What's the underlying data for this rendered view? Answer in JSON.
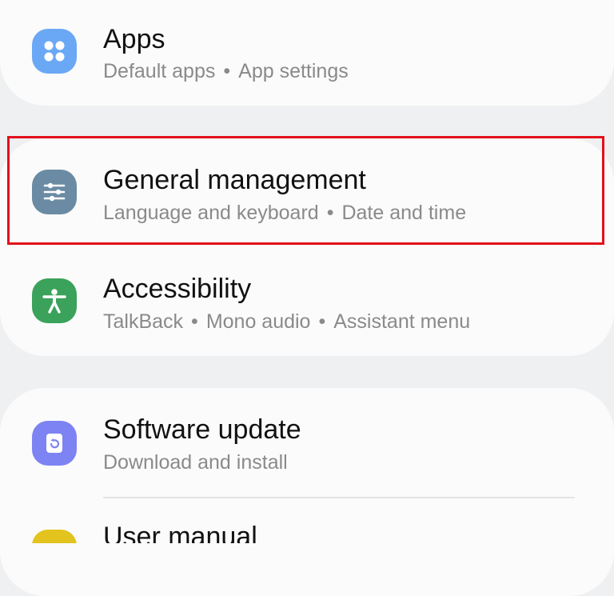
{
  "items": [
    {
      "title": "Apps",
      "subtitle_parts": [
        "Default apps",
        "App settings"
      ],
      "icon": "apps-grid-icon",
      "icon_color": "#6aa8f6"
    },
    {
      "title": "General management",
      "subtitle_parts": [
        "Language and keyboard",
        "Date and time"
      ],
      "icon": "sliders-icon",
      "icon_color": "#6a8ba3"
    },
    {
      "title": "Accessibility",
      "subtitle_parts": [
        "TalkBack",
        "Mono audio",
        "Assistant menu"
      ],
      "icon": "accessibility-person-icon",
      "icon_color": "#3aa25a"
    },
    {
      "title": "Software update",
      "subtitle_parts": [
        "Download and install"
      ],
      "icon": "software-update-icon",
      "icon_color": "#7d83f2"
    },
    {
      "title": "User manual",
      "subtitle_parts": [],
      "icon": "user-manual-icon",
      "icon_color": "#e3c31d"
    }
  ],
  "separator": "•",
  "highlight_color": "#e3101b"
}
